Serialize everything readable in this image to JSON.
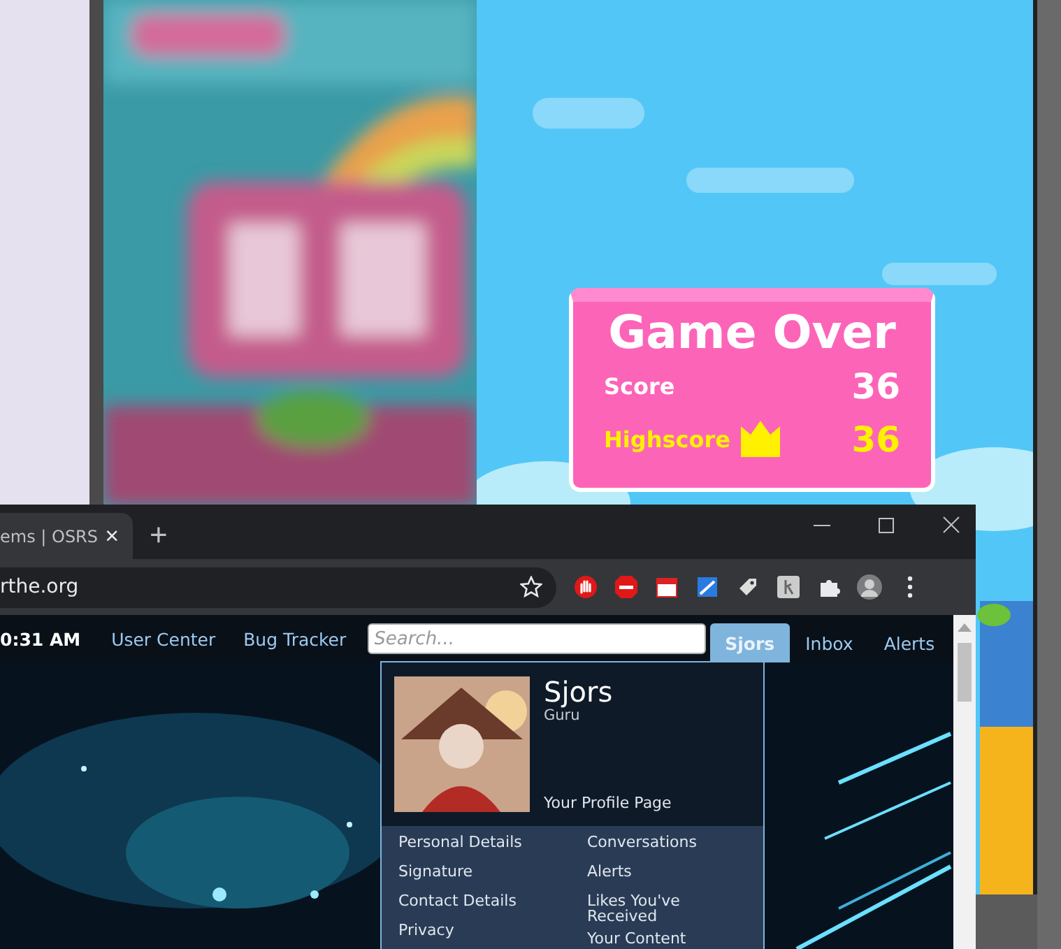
{
  "game": {
    "title": "Game Over",
    "rows": [
      {
        "kind": "score",
        "label": "Score",
        "value": "36"
      },
      {
        "kind": "best",
        "label": "Highscore",
        "value": "36"
      }
    ]
  },
  "browser": {
    "tab": {
      "title": "ems | OSRS",
      "close": "×"
    },
    "new_tab": "+",
    "address": "rthe.org",
    "page": {
      "time": "0:31 AM",
      "nav_links": [
        "User Center",
        "Bug Tracker"
      ],
      "search": {
        "placeholder": "Search..."
      },
      "user_tabs": [
        {
          "label": "Sjors",
          "selected": true
        },
        {
          "label": "Inbox",
          "selected": false
        },
        {
          "label": "Alerts",
          "selected": false
        }
      ],
      "menu": {
        "name": "Sjors",
        "rank": "Guru",
        "profile_link": "Your Profile Page",
        "left_links": [
          "Personal Details",
          "Signature",
          "Contact Details",
          "Privacy"
        ],
        "right_links": [
          "Conversations",
          "Alerts",
          "Likes You've Received",
          "Your Content"
        ]
      }
    }
  }
}
